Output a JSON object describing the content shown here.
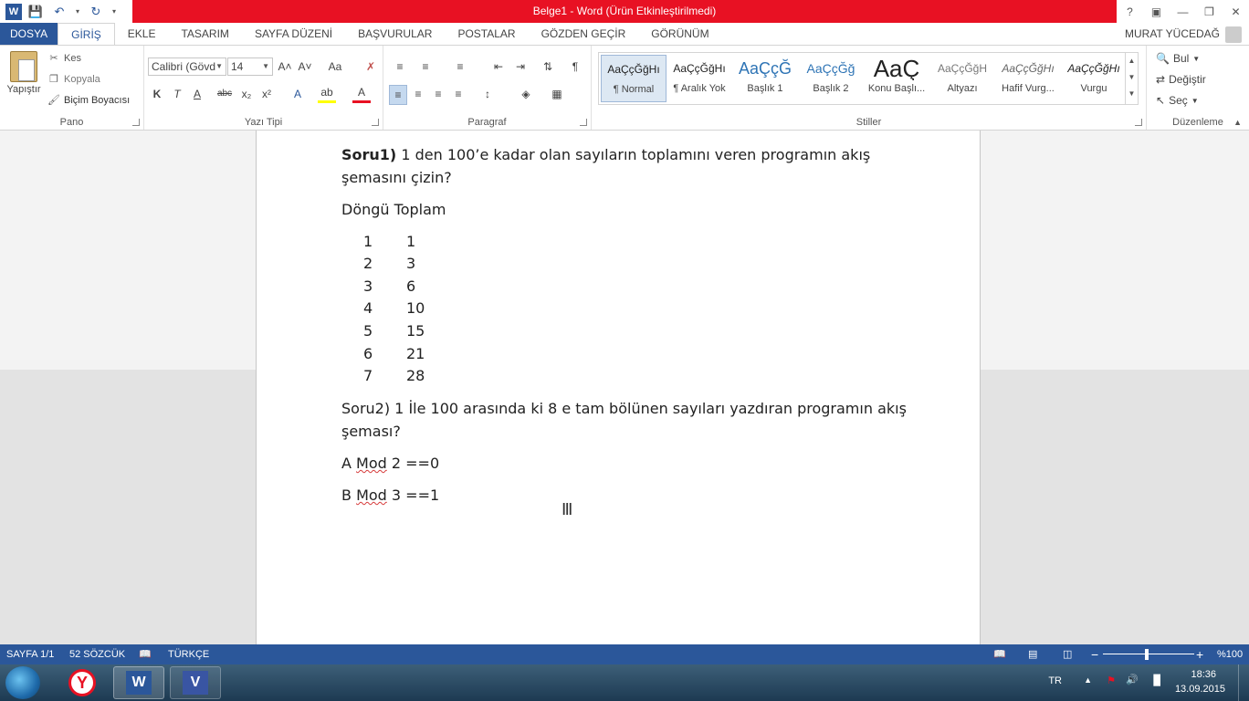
{
  "window": {
    "title": "Belge1 - Word (Ürün Etkinleştirilmedi)",
    "help": "?"
  },
  "tabs": {
    "file": "DOSYA",
    "home": "GİRİŞ",
    "insert": "EKLE",
    "design": "TASARIM",
    "layout": "SAYFA DÜZENİ",
    "references": "BAŞVURULAR",
    "mailings": "POSTALAR",
    "review": "GÖZDEN GEÇİR",
    "view": "GÖRÜNÜM"
  },
  "user": "MURAT YÜCEDAĞ",
  "clipboard": {
    "paste": "Yapıştır",
    "cut": "Kes",
    "copy": "Kopyala",
    "format_painter": "Biçim Boyacısı",
    "label": "Pano"
  },
  "font": {
    "name": "Calibri (Gövd",
    "size": "14",
    "label": "Yazı Tipi",
    "grow": "A˄",
    "shrink": "A˅",
    "case": "Aa",
    "bold": "K",
    "italic": "T",
    "underline": "A",
    "strike": "abc",
    "sub": "x₂",
    "sup": "x²",
    "effects": "A",
    "highlight": "ab",
    "color": "A"
  },
  "paragraph": {
    "label": "Paragraf",
    "pilcrow": "¶"
  },
  "styles": {
    "label": "Stiller",
    "items": [
      {
        "sample": "AaÇçĞğHı",
        "name": "¶ Normal"
      },
      {
        "sample": "AaÇçĞğHı",
        "name": "¶ Aralık Yok"
      },
      {
        "sample": "AaÇçĞ",
        "name": "Başlık 1"
      },
      {
        "sample": "AaÇçĞğ",
        "name": "Başlık 2"
      },
      {
        "sample": "AaÇ",
        "name": "Konu Başlı..."
      },
      {
        "sample": "AaÇçĞğH",
        "name": "Altyazı"
      },
      {
        "sample": "AaÇçĞğHı",
        "name": "Hafif Vurg..."
      },
      {
        "sample": "AaÇçĞğHı",
        "name": "Vurgu"
      }
    ]
  },
  "editing": {
    "label": "Düzenleme",
    "find": "Bul",
    "replace": "Değiştir",
    "select": "Seç"
  },
  "document": {
    "q1_bold": "Soru1)",
    "q1_text": " 1 den 100’e kadar olan sayıların toplamını veren programın akış",
    "q1_line2": "şemasını çizin?",
    "heading": "Döngü Toplam",
    "rows": [
      {
        "a": "1",
        "b": "1"
      },
      {
        "a": "2",
        "b": "3"
      },
      {
        "a": "3",
        "b": "6"
      },
      {
        "a": "4",
        "b": "10"
      },
      {
        "a": "5",
        "b": "15"
      },
      {
        "a": "6",
        "b": "21"
      },
      {
        "a": "7",
        "b": "28"
      }
    ],
    "q2_text": "Soru2) 1 İle 100 arasında ki 8 e tam bölünen sayıları yazdıran programın akış",
    "q2_line2": "şeması?",
    "line_a_pre": "A ",
    "line_a_mod": "Mod",
    "line_a_post": " 2 ==0",
    "line_b_pre": "B ",
    "line_b_mod": "Mod",
    "line_b_post": " 3 ==1"
  },
  "status": {
    "page": "SAYFA 1/1",
    "words": "52 SÖZCÜK",
    "language": "TÜRKÇE",
    "zoom": "%100"
  },
  "taskbar": {
    "lang": "TR",
    "time": "18:36",
    "date": "13.09.2015"
  }
}
